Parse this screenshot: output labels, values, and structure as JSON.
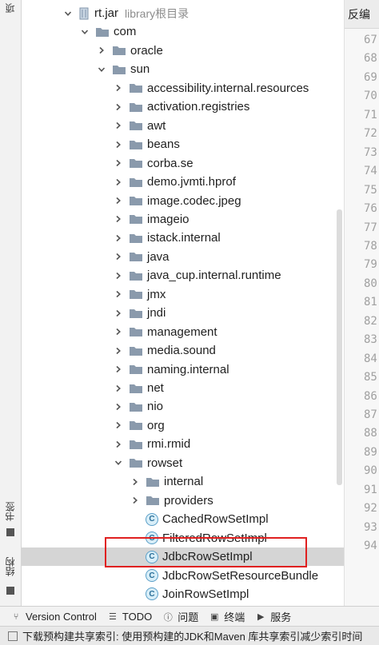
{
  "left_strip": {
    "tab_top": "项",
    "tab_bookmarks": "书签",
    "tab_structure": "结构"
  },
  "tree": [
    {
      "label": "rt.jar",
      "secondary": "library根目录",
      "type": "jar",
      "state": "expanded",
      "level": 0
    },
    {
      "label": "com",
      "type": "folder",
      "state": "expanded",
      "level": 1
    },
    {
      "label": "oracle",
      "type": "folder",
      "state": "collapsed",
      "level": 2
    },
    {
      "label": "sun",
      "type": "folder",
      "state": "expanded",
      "level": 2
    },
    {
      "label": "accessibility.internal.resources",
      "type": "folder",
      "state": "collapsed",
      "level": 3
    },
    {
      "label": "activation.registries",
      "type": "folder",
      "state": "collapsed",
      "level": 3
    },
    {
      "label": "awt",
      "type": "folder",
      "state": "collapsed",
      "level": 3
    },
    {
      "label": "beans",
      "type": "folder",
      "state": "collapsed",
      "level": 3
    },
    {
      "label": "corba.se",
      "type": "folder",
      "state": "collapsed",
      "level": 3
    },
    {
      "label": "demo.jvmti.hprof",
      "type": "folder",
      "state": "collapsed",
      "level": 3
    },
    {
      "label": "image.codec.jpeg",
      "type": "folder",
      "state": "collapsed",
      "level": 3
    },
    {
      "label": "imageio",
      "type": "folder",
      "state": "collapsed",
      "level": 3
    },
    {
      "label": "istack.internal",
      "type": "folder",
      "state": "collapsed",
      "level": 3
    },
    {
      "label": "java",
      "type": "folder",
      "state": "collapsed",
      "level": 3
    },
    {
      "label": "java_cup.internal.runtime",
      "type": "folder",
      "state": "collapsed",
      "level": 3
    },
    {
      "label": "jmx",
      "type": "folder",
      "state": "collapsed",
      "level": 3
    },
    {
      "label": "jndi",
      "type": "folder",
      "state": "collapsed",
      "level": 3
    },
    {
      "label": "management",
      "type": "folder",
      "state": "collapsed",
      "level": 3
    },
    {
      "label": "media.sound",
      "type": "folder",
      "state": "collapsed",
      "level": 3
    },
    {
      "label": "naming.internal",
      "type": "folder",
      "state": "collapsed",
      "level": 3
    },
    {
      "label": "net",
      "type": "folder",
      "state": "collapsed",
      "level": 3
    },
    {
      "label": "nio",
      "type": "folder",
      "state": "collapsed",
      "level": 3
    },
    {
      "label": "org",
      "type": "folder",
      "state": "collapsed",
      "level": 3
    },
    {
      "label": "rmi.rmid",
      "type": "folder",
      "state": "collapsed",
      "level": 3
    },
    {
      "label": "rowset",
      "type": "folder",
      "state": "expanded",
      "level": 3
    },
    {
      "label": "internal",
      "type": "folder",
      "state": "collapsed",
      "level": 4
    },
    {
      "label": "providers",
      "type": "folder",
      "state": "collapsed",
      "level": 4
    },
    {
      "label": "CachedRowSetImpl",
      "type": "class",
      "state": "leaf",
      "level": 4
    },
    {
      "label": "FilteredRowSetImpl",
      "type": "class",
      "state": "leaf",
      "level": 4
    },
    {
      "label": "JdbcRowSetImpl",
      "type": "class",
      "state": "leaf",
      "level": 4,
      "selected": true
    },
    {
      "label": "JdbcRowSetResourceBundle",
      "type": "class",
      "state": "leaf",
      "level": 4
    },
    {
      "label": "JoinRowSetImpl",
      "type": "class",
      "state": "leaf",
      "level": 4
    }
  ],
  "editor": {
    "tab_label": "反编",
    "line_numbers": [
      "67",
      "68",
      "69",
      "70",
      "71",
      "72",
      "73",
      "74",
      "75",
      "76",
      "77",
      "78",
      "79",
      "80",
      "81",
      "82",
      "83",
      "84",
      "85",
      "86",
      "87",
      "88",
      "89",
      "90",
      "91",
      "92",
      "93",
      "94"
    ]
  },
  "toolbar": {
    "items": [
      {
        "label": "Version Control",
        "icon": "branch-icon"
      },
      {
        "label": "TODO",
        "icon": "list-icon"
      },
      {
        "label": "问题",
        "icon": "problems-icon"
      },
      {
        "label": "终端",
        "icon": "terminal-icon"
      },
      {
        "label": "服务",
        "icon": "services-icon"
      }
    ]
  },
  "status": {
    "text": "下载预构建共享索引: 使用预构建的JDK和Maven 库共享索引减少索引时间"
  },
  "colors": {
    "selection": "#d5d5d5",
    "highlight_border": "#e02020",
    "folder": "#8a9aac",
    "class_icon": "#2a6f99"
  }
}
